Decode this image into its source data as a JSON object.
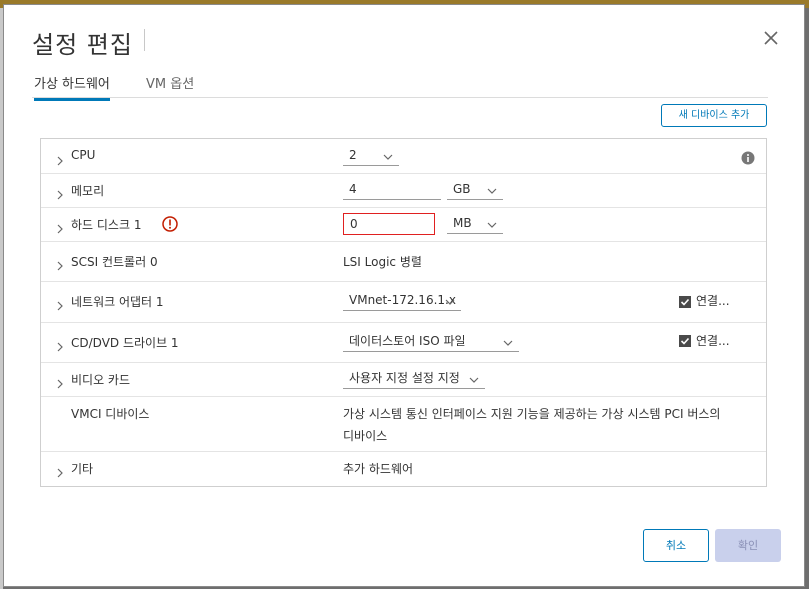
{
  "dialog": {
    "title": "설정 편집"
  },
  "tabs": [
    {
      "label": "가상 하드웨어",
      "active": true
    },
    {
      "label": "VM 옵션",
      "active": false
    }
  ],
  "add_device_label": "새 디바이스 추가",
  "rows": {
    "cpu": {
      "label": "CPU",
      "value": "2"
    },
    "memory": {
      "label": "메모리",
      "value": "4",
      "unit": "GB"
    },
    "disk": {
      "label": "하드 디스크 1",
      "value": "0",
      "unit": "MB"
    },
    "scsi": {
      "label": "SCSI 컨트롤러 0",
      "value": "LSI Logic 병렬"
    },
    "network": {
      "label": "네트워크 어댑터 1",
      "value": "VMnet-172.16.1.x",
      "connect_label": "연결...",
      "connected": true
    },
    "cddvd": {
      "label": "CD/DVD 드라이브 1",
      "value": "데이터스토어 ISO 파일",
      "connect_label": "연결...",
      "connected": true
    },
    "video": {
      "label": "비디오 카드",
      "value": "사용자 지정 설정 지정"
    },
    "vmci": {
      "label": "VMCI 디바이스",
      "value_line1": "가상 시스템 통신 인터페이스 지원 기능을 제공하는 가상 시스템 PCI 버스의",
      "value_line2": "디바이스"
    },
    "other": {
      "label": "기타",
      "value": "추가 하드웨어"
    }
  },
  "footer": {
    "cancel_label": "취소",
    "ok_label": "확인"
  },
  "colors": {
    "accent": "#0079b8",
    "error": "#e02020",
    "disabled_bg": "#c9d0ec"
  }
}
